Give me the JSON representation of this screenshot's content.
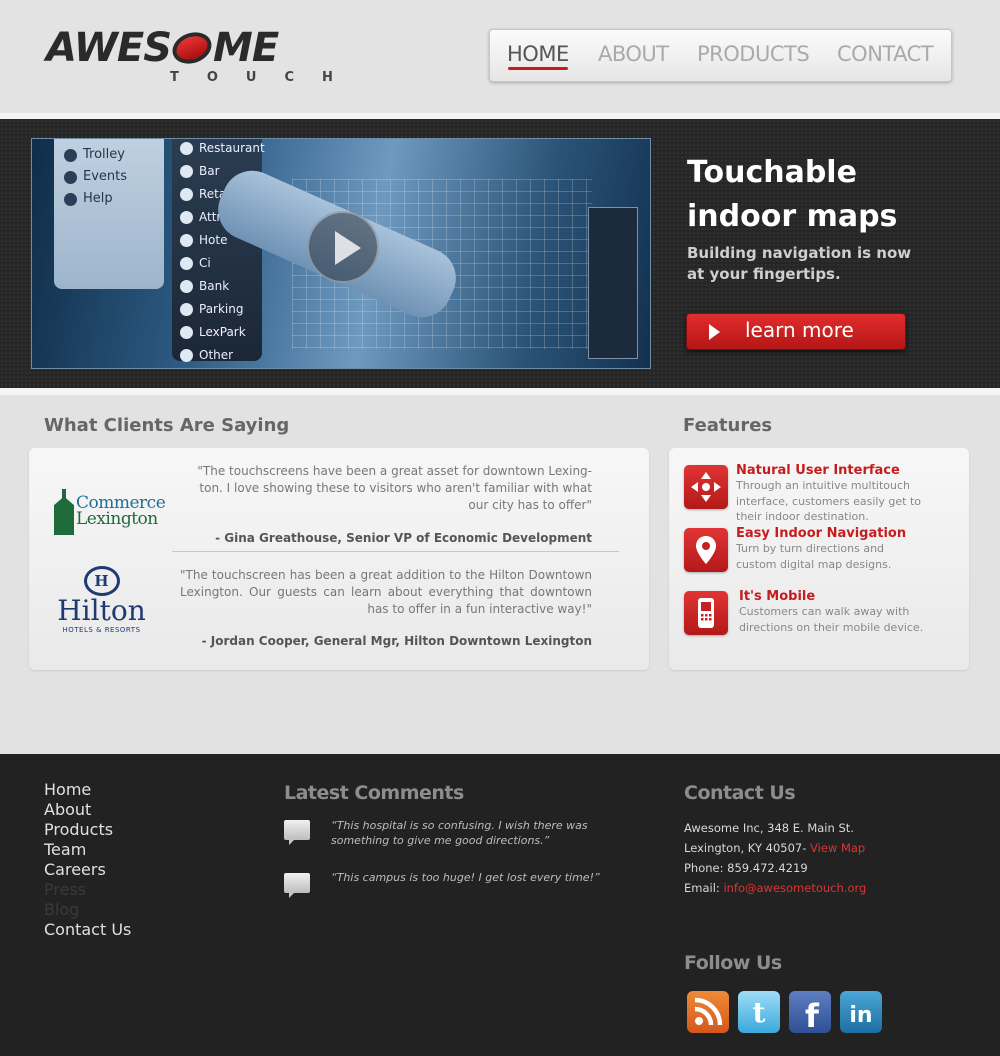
{
  "brand": {
    "logo_main_left": "AWES",
    "logo_main_right": "ME",
    "logo_sub": "TOUCH"
  },
  "nav": {
    "items": [
      "HOME",
      "ABOUT",
      "PRODUCTS",
      "CONTACT"
    ],
    "active": "HOME"
  },
  "hero": {
    "video_menu_left": [
      "Trolley",
      "Events",
      "Help"
    ],
    "video_menu_right": [
      "Restaurant",
      "Bar",
      "Retail",
      "Attr",
      "Hote",
      "Ci",
      "Bank",
      "Parking",
      "LexPark",
      "Other"
    ],
    "title_line1": "Touchable",
    "title_line2": "indoor maps",
    "subtitle": "Building navigation is now at your fingertips.",
    "cta_label": "learn more"
  },
  "testimonials": {
    "heading": "What Clients Are Saying",
    "items": [
      {
        "logo": "Commerce Lexington",
        "logo_line1": "Commerce",
        "logo_line2": "Lexington",
        "quote": "\"The touchscreens have been a great asset for downtown Lexing-ton. I love showing these to visitors who aren't familiar with what our city has to offer\"",
        "author": "- Gina Greathouse, Senior VP of Economic Development"
      },
      {
        "logo": "Hilton Hotels & Resorts",
        "logo_name": "Hilton",
        "logo_sub": "HOTELS & RESORTS",
        "quote": "\"The touchscreen has been a great addition to the Hilton Downtown Lexington. Our guests can learn about everything that downtown has to offer in a fun interactive way!\"",
        "author": "- Jordan Cooper, General Mgr, Hilton Downtown Lexington"
      }
    ]
  },
  "features": {
    "heading": "Features",
    "items": [
      {
        "title": "Natural User Interface",
        "desc": "Through an intuitive multitouch interface, customers easily get to their indoor destination.",
        "icon": "move-arrows-icon"
      },
      {
        "title": "Easy Indoor Navigation",
        "desc": "Turn by turn directions and custom digital map designs.",
        "icon": "map-pin-icon"
      },
      {
        "title": "It's Mobile",
        "desc": "Customers can walk away with directions on their mobile device.",
        "icon": "mobile-phone-icon"
      }
    ]
  },
  "footer": {
    "nav": [
      "Home",
      "About",
      "Products",
      "Team",
      "Careers",
      "Press",
      "Blog",
      "Contact Us"
    ],
    "comments_heading": "Latest Comments",
    "comments": [
      "“This hospital is so confusing. I wish there was something to give me good directions.”",
      "“This campus is too huge! I get lost every time!”"
    ],
    "contact_heading": "Contact Us",
    "contact": {
      "line1": "Awesome Inc, 348 E. Main St.",
      "line2_prefix": "Lexington, KY 40507- ",
      "map_link": "View Map",
      "phone": "Phone: 859.472.4219",
      "email_prefix": "Email: ",
      "email": "info@awesometouch.org"
    },
    "follow_heading": "Follow Us",
    "social": [
      "rss-icon",
      "twitter-icon",
      "facebook-icon",
      "linkedin-icon"
    ]
  }
}
